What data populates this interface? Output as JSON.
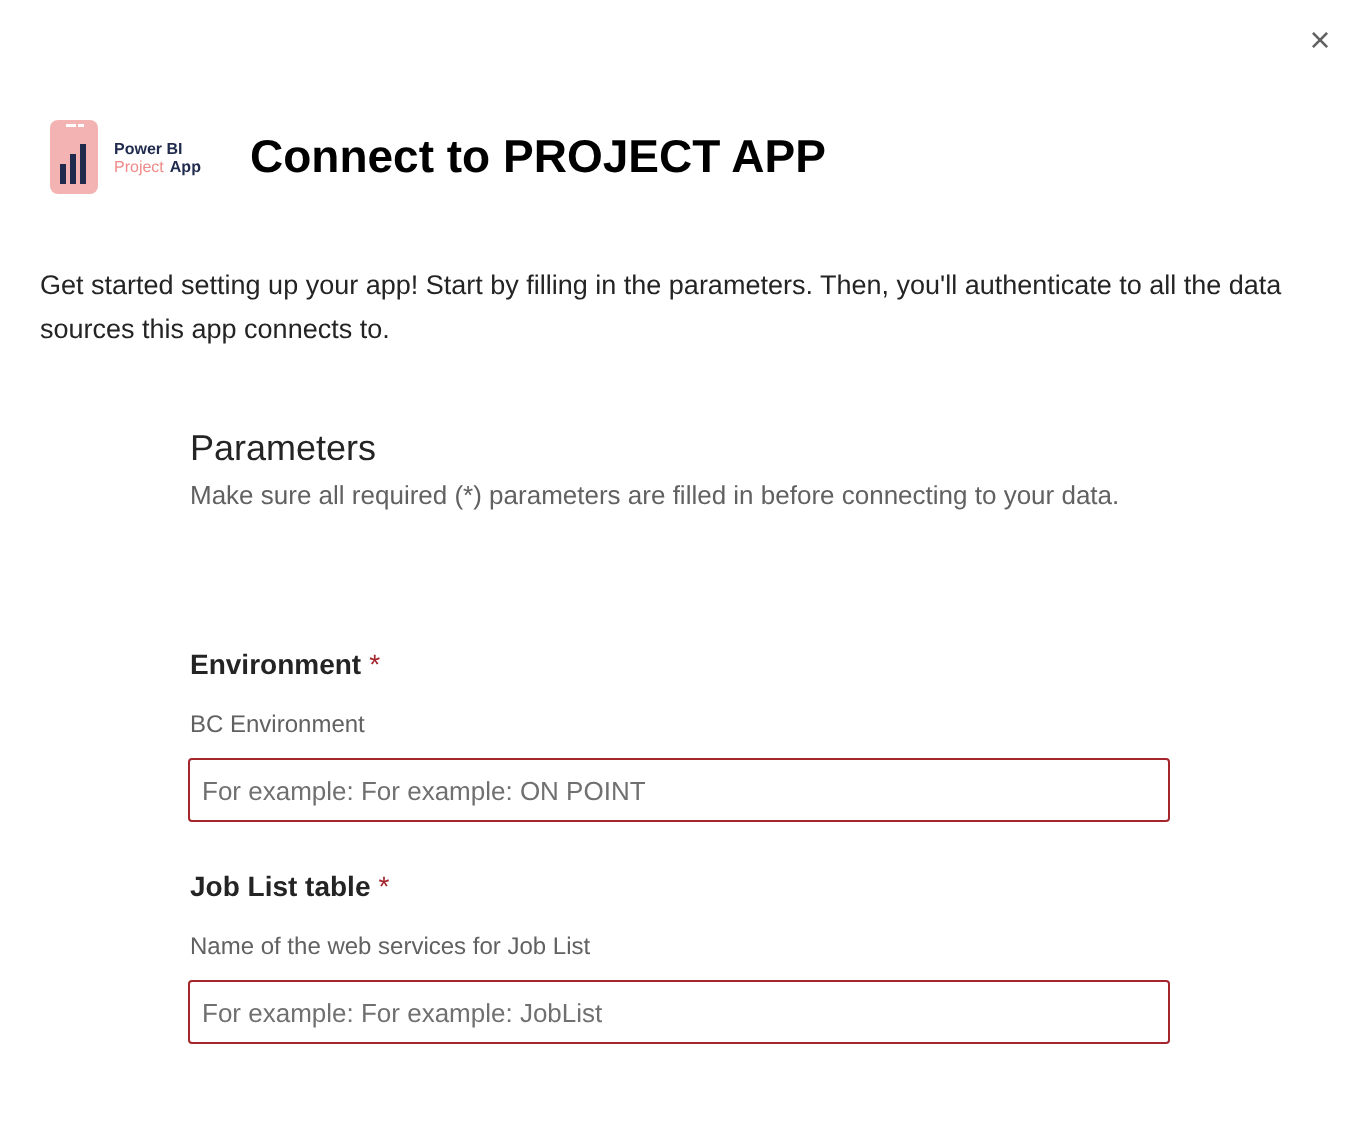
{
  "close_button": "×",
  "logo": {
    "line_1": "Power BI",
    "line_2_accent": "Project",
    "line_2": "App"
  },
  "title": "Connect to PROJECT APP",
  "intro": "Get started setting up your app! Start by filling in the parameters. Then, you'll authenticate to all the data sources this app connects to.",
  "parameters": {
    "heading": "Parameters",
    "description": "Make sure all required (*) parameters are filled in before connecting to your data.",
    "fields": [
      {
        "label": "Environment",
        "required": true,
        "required_mark": "*",
        "description": "BC Environment",
        "placeholder": "For example: For example: ON POINT",
        "invalid": true
      },
      {
        "label": "Job List table",
        "required": true,
        "required_mark": "*",
        "description": "Name of the web services for Job List",
        "placeholder": "For example: For example: JobList",
        "invalid": true
      }
    ]
  }
}
